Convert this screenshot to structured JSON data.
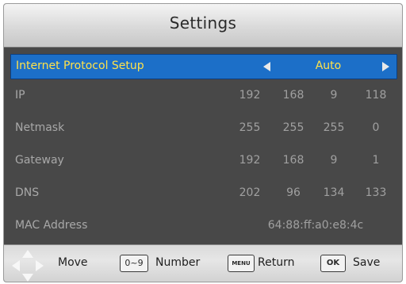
{
  "title": "Settings",
  "protocol": {
    "label": "Internet Protocol Setup",
    "value": "Auto"
  },
  "rows": [
    {
      "label": "IP",
      "values": [
        "192",
        "168",
        "9",
        "118"
      ]
    },
    {
      "label": "Netmask",
      "values": [
        "255",
        "255",
        "255",
        "0"
      ]
    },
    {
      "label": "Gateway",
      "values": [
        "192",
        "168",
        "9",
        "1"
      ]
    },
    {
      "label": "DNS",
      "values": [
        "202",
        "96",
        "134",
        "133"
      ]
    }
  ],
  "mac": {
    "label": "MAC Address",
    "value": "64:88:ff:a0:e8:4c"
  },
  "footer": {
    "move": "Move",
    "number_key": "0~9",
    "number": "Number",
    "menu_key": "MENU",
    "return": "Return",
    "ok_key": "OK",
    "save": "Save"
  },
  "colors": {
    "selected_bg": "#1c6fc8",
    "selected_text": "#ffe24a",
    "panel_bg": "#484848",
    "muted_text": "#a0a0a0"
  },
  "icons": {
    "selector_left": "arrow-left-icon",
    "selector_right": "arrow-right-icon",
    "dpad": "dpad-icon"
  }
}
